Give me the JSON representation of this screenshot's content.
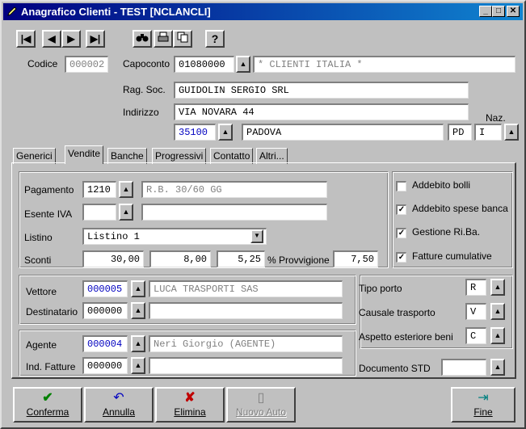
{
  "window": {
    "title": "Anagrafico Clienti - TEST [NCLANCLI]"
  },
  "title_buttons": [
    "_",
    "□",
    "✕"
  ],
  "toolbar": {
    "nav": [
      "|◀",
      "◀",
      "▶",
      "▶|"
    ],
    "tools": [
      {
        "icon": "binoculars-icon",
        "glyph": "👓"
      },
      {
        "icon": "printer-icon",
        "glyph": "🖶"
      },
      {
        "icon": "copy-icon",
        "glyph": "⧉"
      },
      {
        "icon": "help-icon",
        "glyph": "?"
      }
    ]
  },
  "header": {
    "codice_label": "Codice",
    "codice_value": "000002",
    "capoconto_label": "Capoconto",
    "capoconto_value": "01080000",
    "capoconto_desc": "* CLIENTI ITALIA *",
    "ragsoc_label": "Rag. Soc.",
    "ragsoc_value": "GUIDOLIN SERGIO SRL",
    "indirizzo_label": "Indirizzo",
    "indirizzo_value": "VIA NOVARA 44",
    "cap_value": "35100",
    "citta_value": "PADOVA",
    "prov_value": "PD",
    "naz_label": "Naz.",
    "naz_value": "I"
  },
  "tabs": [
    {
      "label": "Generici"
    },
    {
      "label": "Vendite"
    },
    {
      "label": "Banche"
    },
    {
      "label": "Progressivi"
    },
    {
      "label": "Contatto"
    },
    {
      "label": "Altri..."
    }
  ],
  "active_tab": "Vendite",
  "vendite": {
    "pagamento_label": "Pagamento",
    "pagamento_code": "1210",
    "pagamento_desc": "R.B. 30/60 GG",
    "esente_label": "Esente IVA",
    "esente_code": "",
    "esente_desc": "",
    "listino_label": "Listino",
    "listino_value": "Listino 1",
    "sconti_label": "Sconti",
    "sconto1": "30,00",
    "sconto2": "8,00",
    "sconto3": "5,25",
    "provvigione_label": "% Provvigione",
    "provvigione_value": "7,50",
    "checks": [
      {
        "label": "Addebito bolli",
        "checked": false
      },
      {
        "label": "Addebito spese banca",
        "checked": true
      },
      {
        "label": "Gestione Ri.Ba.",
        "checked": true
      },
      {
        "label": "Fatture cumulative",
        "checked": true
      }
    ],
    "vettore_label": "Vettore",
    "vettore_code": "000005",
    "vettore_desc": "LUCA TRASPORTI SAS",
    "destinatario_label": "Destinatario",
    "destinatario_code": "000000",
    "destinatario_desc": "",
    "agente_label": "Agente",
    "agente_code": "000004",
    "agente_desc": "Neri Giorgio (AGENTE)",
    "indfatture_label": "Ind. Fatture",
    "indfatture_code": "000000",
    "indfatture_desc": "",
    "tipoporto_label": "Tipo porto",
    "tipoporto_value": "R",
    "causale_label": "Causale trasporto",
    "causale_value": "V",
    "aspetto_label": "Aspetto esteriore beni",
    "aspetto_value": "C",
    "docstd_label": "Documento STD",
    "docstd_value": ""
  },
  "buttons": {
    "conferma": "Conferma",
    "annulla": "Annulla",
    "elimina": "Elimina",
    "nuovo_auto": "Nuovo Auto",
    "fine": "Fine"
  },
  "colors": {
    "title_start": "#000080",
    "title_end": "#1084d0",
    "face": "#c0c0c0",
    "code_blue": "#0000c0"
  }
}
